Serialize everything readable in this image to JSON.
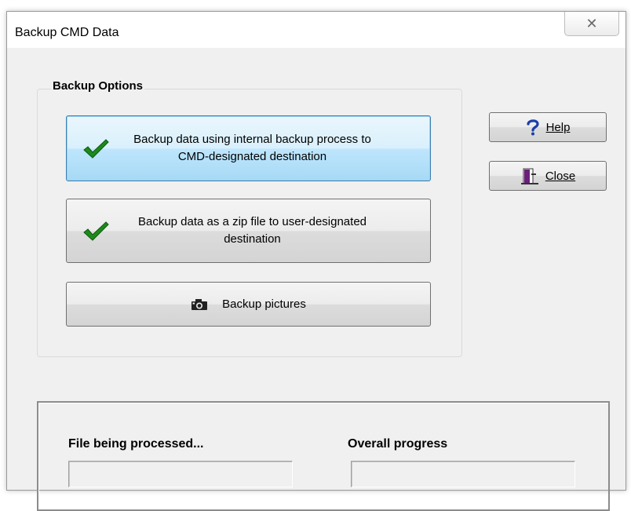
{
  "window": {
    "title": "Backup CMD Data",
    "close_glyph": "✕"
  },
  "backup_options": {
    "group_title": "Backup Options",
    "internal_backup": {
      "line1": "Backup data using internal backup process to",
      "line2": "CMD-designated destination",
      "icon": "checkmark-icon"
    },
    "zip_backup": {
      "line1": "Backup data as a zip file to user-designated",
      "line2": "destination",
      "icon": "checkmark-icon"
    },
    "pictures_backup": {
      "label": "Backup pictures",
      "icon": "camera-icon"
    }
  },
  "side_buttons": {
    "help_label": "Help",
    "help_icon": "question-mark-icon",
    "close_label": "Close",
    "close_icon": "exit-door-icon"
  },
  "progress": {
    "file_label": "File being processed...",
    "overall_label": "Overall progress",
    "file_value": 0,
    "overall_value": 0
  },
  "colors": {
    "accent_check": "#1c8a1c",
    "help_icon": "#1b3fa8",
    "door_icon": "#6b1f7a"
  }
}
